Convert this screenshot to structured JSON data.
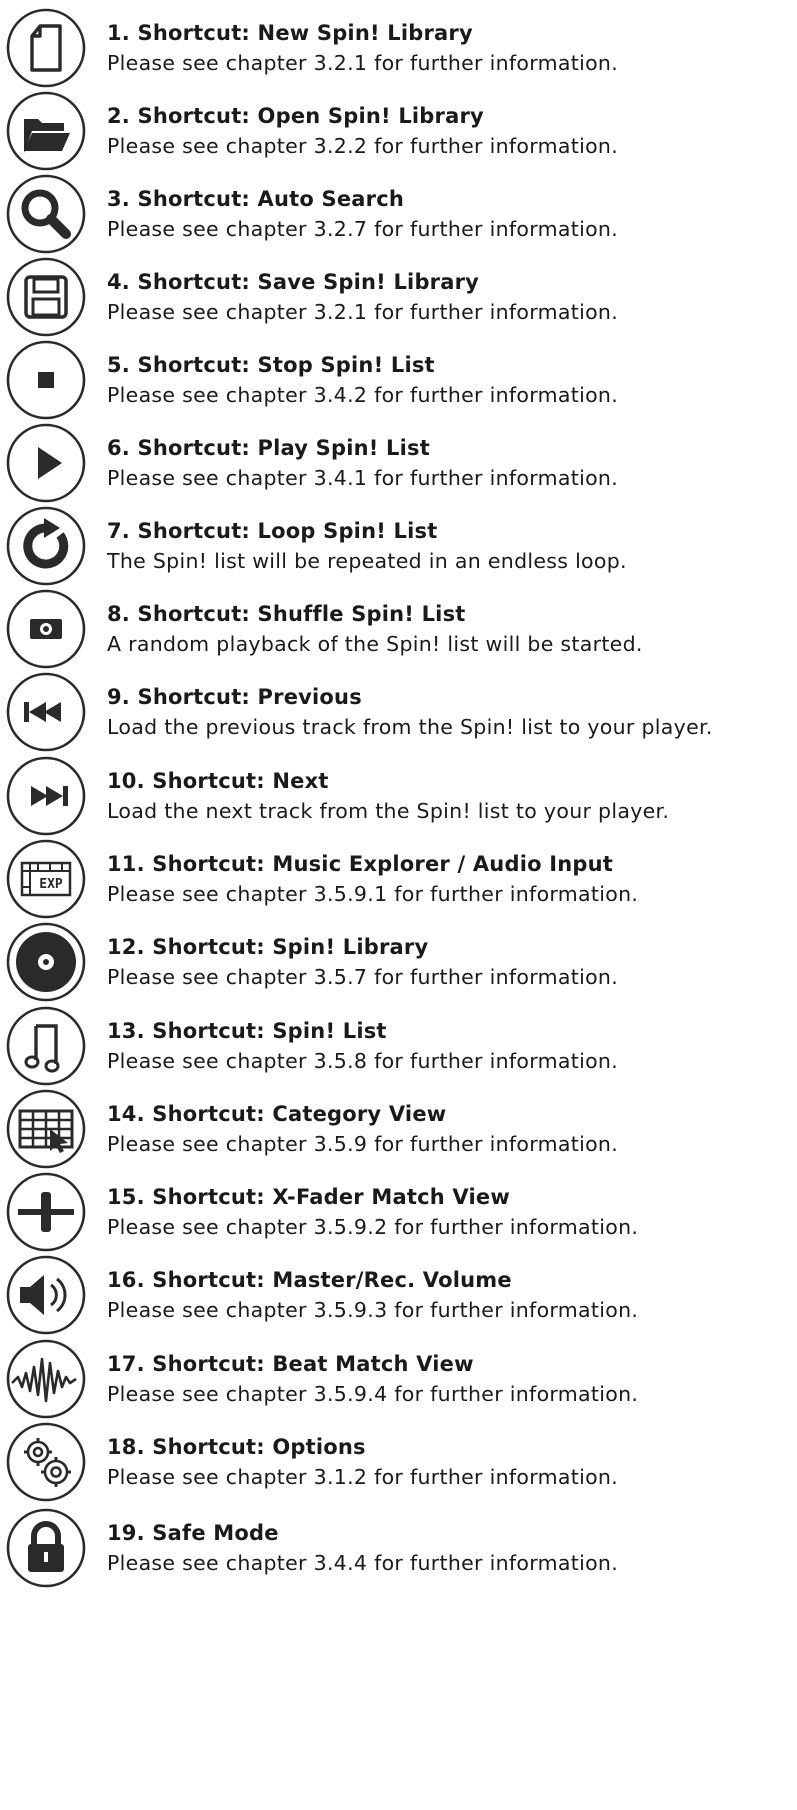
{
  "items": [
    {
      "icon": "new-document-icon",
      "title": "1. Shortcut: New Spin! Library",
      "desc": "Please see chapter 3.2.1 for further information."
    },
    {
      "icon": "open-folder-icon",
      "title": "2. Shortcut: Open Spin! Library",
      "desc": "Please see chapter 3.2.2 for further information."
    },
    {
      "icon": "search-icon",
      "title": "3. Shortcut: Auto Search",
      "desc": "Please see chapter 3.2.7 for further information."
    },
    {
      "icon": "save-disk-icon",
      "title": "4. Shortcut: Save Spin! Library",
      "desc": "Please see chapter 3.2.1 for further information."
    },
    {
      "icon": "stop-icon",
      "title": "5. Shortcut: Stop Spin! List",
      "desc": "Please see chapter 3.4.2 for further information."
    },
    {
      "icon": "play-icon",
      "title": "6. Shortcut: Play Spin! List",
      "desc": "Please see chapter 3.4.1 for further information."
    },
    {
      "icon": "loop-icon",
      "title": "7. Shortcut: Loop Spin! List",
      "desc": "The Spin! list will be repeated in an endless loop."
    },
    {
      "icon": "shuffle-icon",
      "title": "8. Shortcut: Shuffle Spin! List",
      "desc": "A random playback of the Spin! list will be started."
    },
    {
      "icon": "previous-icon",
      "title": "9. Shortcut: Previous",
      "desc": "Load the previous track from the Spin! list to your player."
    },
    {
      "icon": "next-icon",
      "title": "10. Shortcut: Next",
      "desc": "Load the next track from the Spin! list to your player."
    },
    {
      "icon": "music-explorer-icon",
      "title": "11. Shortcut: Music Explorer / Audio Input",
      "desc": "Please see chapter 3.5.9.1 for further information.",
      "icon_text": "EXP"
    },
    {
      "icon": "disc-icon",
      "title": "12. Shortcut: Spin! Library",
      "desc": "Please see chapter 3.5.7 for further information."
    },
    {
      "icon": "music-note-icon",
      "title": "13. Shortcut: Spin! List",
      "desc": "Please see chapter 3.5.8 for further information."
    },
    {
      "icon": "category-grid-icon",
      "title": "14. Shortcut: Category View",
      "desc": "Please see chapter 3.5.9 for further information."
    },
    {
      "icon": "crossfader-icon",
      "title": "15. Shortcut: X-Fader Match View",
      "desc": "Please see chapter 3.5.9.2 for further information."
    },
    {
      "icon": "speaker-volume-icon",
      "title": "16. Shortcut: Master/Rec. Volume",
      "desc": "Please see chapter 3.5.9.3 for further information."
    },
    {
      "icon": "waveform-icon",
      "title": "17. Shortcut: Beat Match View",
      "desc": "Please see chapter 3.5.9.4 for further information."
    },
    {
      "icon": "gears-icon",
      "title": "18. Shortcut: Options",
      "desc": "Please see chapter 3.1.2 for further information."
    },
    {
      "icon": "lock-icon",
      "title": "19. Safe Mode",
      "desc": "Please see chapter 3.4.4 for further information."
    }
  ]
}
